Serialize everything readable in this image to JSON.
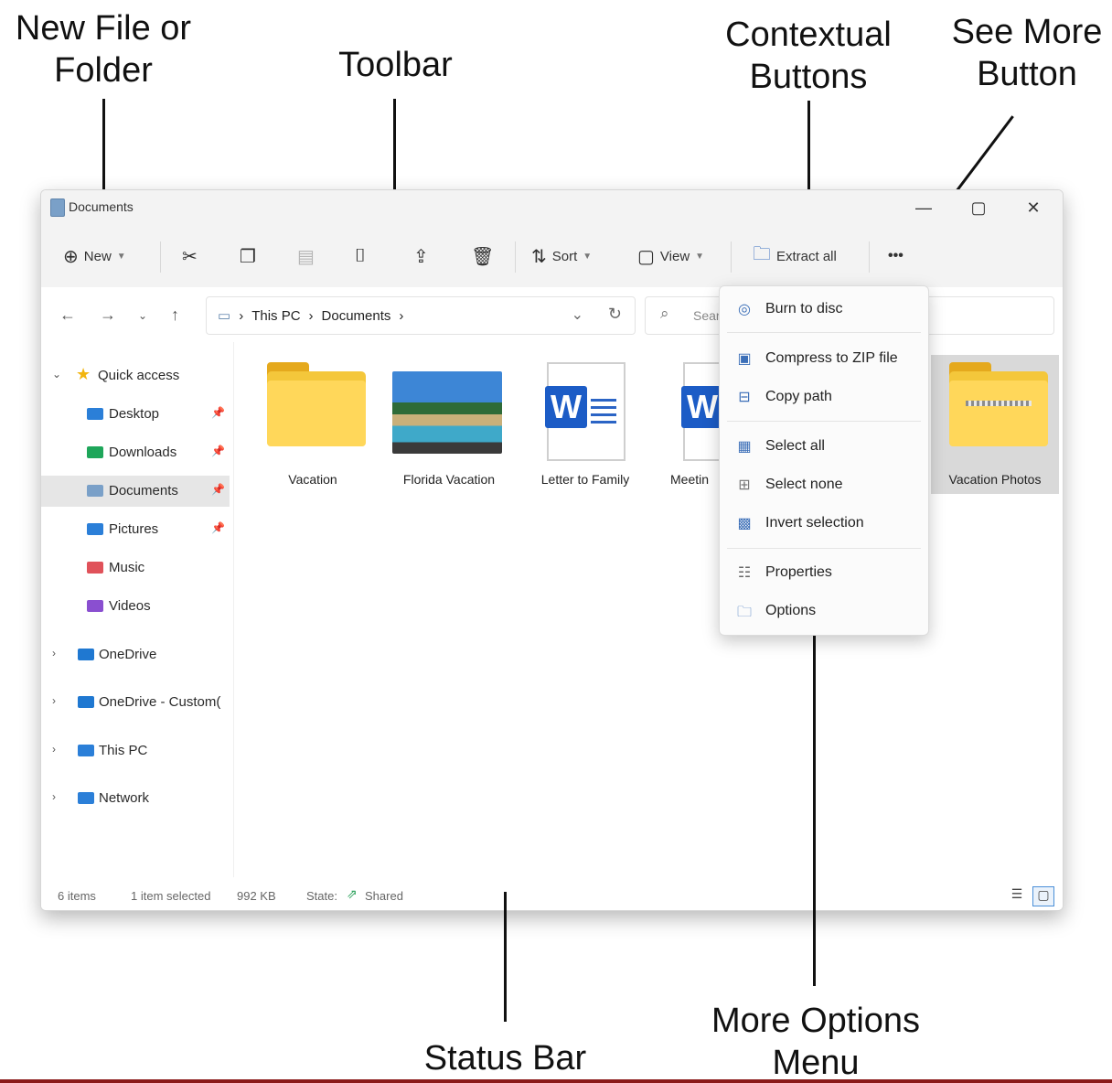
{
  "callouts": {
    "new_file_or_folder": "New File or\nFolder",
    "toolbar": "Toolbar",
    "contextual_buttons": "Contextual\nButtons",
    "see_more_button": "See More\nButton",
    "status_bar": "Status Bar",
    "more_options_menu": "More Options\nMenu"
  },
  "window": {
    "title": "Documents",
    "controls": {
      "minimize": "—",
      "maximize": "▢",
      "close": "✕"
    }
  },
  "toolbar": {
    "new_label": "New",
    "sort_label": "Sort",
    "view_label": "View",
    "extract_label": "Extract all",
    "see_more_label": "•••",
    "icons": [
      "cut-icon",
      "copy-icon",
      "paste-icon",
      "rename-icon",
      "share-icon",
      "delete-icon"
    ]
  },
  "address": {
    "crumbs": [
      "This PC",
      "Documents"
    ],
    "search_placeholder": "Sear"
  },
  "sidebar": {
    "items": [
      {
        "label": "Quick access",
        "icon": "star-icon",
        "color": "#f2b50f"
      },
      {
        "label": "Desktop",
        "icon": "desktop-folder-icon",
        "color": "#2b7fd8"
      },
      {
        "label": "Downloads",
        "icon": "downloads-folder-icon",
        "color": "#1ea65a"
      },
      {
        "label": "Documents",
        "icon": "documents-folder-icon",
        "color": "#7aa0c8"
      },
      {
        "label": "Pictures",
        "icon": "pictures-folder-icon",
        "color": "#2b7fd8"
      },
      {
        "label": "Music",
        "icon": "music-folder-icon",
        "color": "#e0525a"
      },
      {
        "label": "Videos",
        "icon": "videos-folder-icon",
        "color": "#8a4fd0"
      },
      {
        "label": "OneDrive",
        "icon": "onedrive-folder-icon",
        "color": "#1f78d1"
      },
      {
        "label": "OneDrive - Custom(",
        "icon": "onedrive-folder-icon",
        "color": "#1f78d1"
      },
      {
        "label": "This PC",
        "icon": "computer-icon",
        "color": "#2b7fd8"
      },
      {
        "label": "Network",
        "icon": "network-icon",
        "color": "#2b7fd8"
      }
    ]
  },
  "files": [
    {
      "label": "Vacation",
      "type": "folder"
    },
    {
      "label": "Florida Vacation",
      "type": "image"
    },
    {
      "label": "Letter to Family",
      "type": "word"
    },
    {
      "label": "Meetin",
      "type": "word"
    },
    {
      "label": "Vacation Photos",
      "type": "zip-folder"
    }
  ],
  "more_menu": {
    "items": [
      {
        "label": "Burn to disc",
        "icon": "disc-icon"
      },
      {
        "label": "Compress to ZIP file",
        "icon": "zip-icon"
      },
      {
        "label": "Copy path",
        "icon": "copy-path-icon"
      },
      {
        "label": "Select all",
        "icon": "select-all-icon"
      },
      {
        "label": "Select none",
        "icon": "select-none-icon"
      },
      {
        "label": "Invert selection",
        "icon": "invert-selection-icon"
      },
      {
        "label": "Properties",
        "icon": "properties-icon"
      },
      {
        "label": "Options",
        "icon": "options-icon"
      }
    ]
  },
  "status": {
    "item_count": "6 items",
    "selection": "1 item selected",
    "size": "992 KB",
    "state_label": "State:",
    "state_value": "Shared"
  }
}
